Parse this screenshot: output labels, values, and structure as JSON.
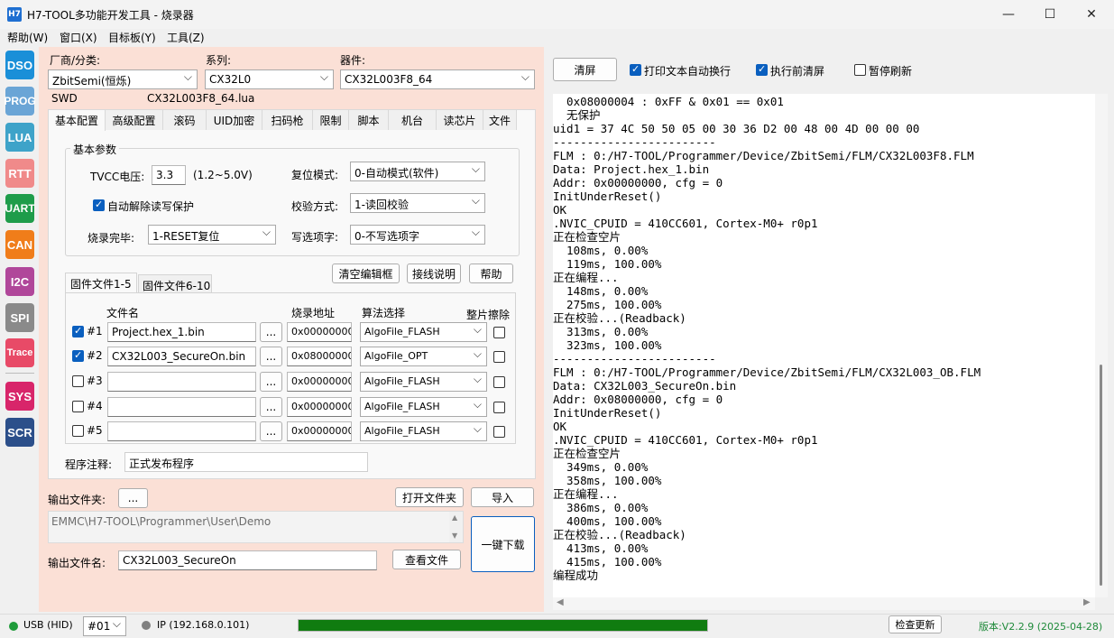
{
  "window": {
    "title": "H7-TOOL多功能开发工具 - 烧录器",
    "icon_text": "H7"
  },
  "menu": [
    "帮助(W)",
    "窗口(X)",
    "目标板(Y)",
    "工具(Z)"
  ],
  "tools": [
    {
      "label": "DSO",
      "color": "#1a8fd8"
    },
    {
      "label": "PROG",
      "color": "#6aa5d6"
    },
    {
      "label": "LUA",
      "color": "#3ea3c9"
    },
    {
      "label": "RTT",
      "color": "#f08a8a"
    },
    {
      "label": "UART",
      "color": "#1e9c4a"
    },
    {
      "label": "CAN",
      "color": "#f07d1a"
    },
    {
      "label": "I2C",
      "color": "#b0479a"
    },
    {
      "label": "SPI",
      "color": "#8a8a8a"
    },
    {
      "label": "Trace",
      "color": "#e84a67"
    },
    {
      "label": "SYS",
      "color": "#d8256a"
    },
    {
      "label": "SCR",
      "color": "#2c4f8a"
    }
  ],
  "device_select": {
    "vendor_label": "厂商/分类:",
    "vendor_value": "ZbitSemi(恒烁)",
    "series_label": "系列:",
    "series_value": "CX32L0",
    "device_label": "器件:",
    "device_value": "CX32L003F8_64",
    "interface": "SWD",
    "lua_file": "CX32L003F8_64.lua"
  },
  "tabs": [
    "基本配置",
    "高级配置",
    "滚码",
    "UID加密",
    "扫码枪",
    "限制",
    "脚本",
    "机台",
    "读芯片",
    "文件"
  ],
  "basic": {
    "group_title": "基本参数",
    "tvcc_label": "TVCC电压:",
    "tvcc_value": "3.3",
    "tvcc_range": "(1.2~5.0V)",
    "reset_label": "复位模式:",
    "reset_value": "0-自动模式(软件)",
    "auto_unprotect_label": "自动解除读写保护",
    "verify_label": "校验方式:",
    "verify_value": "1-读回校验",
    "after_label": "烧录完毕:",
    "after_value": "1-RESET复位",
    "option_label": "写选项字:",
    "option_value": "0-不写选项字"
  },
  "file_section": {
    "subtab1": "固件文件1-5",
    "subtab2": "固件文件6-10",
    "clear_btn": "清空编辑框",
    "wiring_btn": "接线说明",
    "help_btn": "帮助",
    "col_file": "文件名",
    "col_addr": "烧录地址",
    "col_algo": "算法选择",
    "col_erase": "整片擦除",
    "browse": "...",
    "rows": [
      {
        "id": "#1",
        "checked": true,
        "file": "Project.hex_1.bin",
        "addr": "0x00000000",
        "algo": "AlgoFile_FLASH"
      },
      {
        "id": "#2",
        "checked": true,
        "file": "CX32L003_SecureOn.bin",
        "addr": "0x08000000",
        "algo": "AlgoFile_OPT"
      },
      {
        "id": "#3",
        "checked": false,
        "file": "",
        "addr": "0x00000000",
        "algo": "AlgoFile_FLASH"
      },
      {
        "id": "#4",
        "checked": false,
        "file": "",
        "addr": "0x00000000",
        "algo": "AlgoFile_FLASH"
      },
      {
        "id": "#5",
        "checked": false,
        "file": "",
        "addr": "0x00000000",
        "algo": "AlgoFile_FLASH"
      }
    ],
    "note_label": "程序注释:",
    "note_value": "正式发布程序"
  },
  "output": {
    "folder_label": "输出文件夹:",
    "folder_btn": "...",
    "open_folder_btn": "打开文件夹",
    "import_btn": "导入",
    "folder_path": "EMMC\\H7-TOOL\\Programmer\\User\\Demo",
    "download_btn": "一键下载",
    "filename_label": "输出文件名:",
    "filename_value": "CX32L003_SecureOn",
    "view_btn": "查看文件"
  },
  "log_toolbar": {
    "clear_btn": "清屏",
    "wrap_label": "打印文本自动换行",
    "clear_before_label": "执行前清屏",
    "pause_label": "暂停刷新"
  },
  "log_lines": [
    "  0x08000004 : 0xFF & 0x01 == 0x01",
    "  无保护",
    "uid1 = 37 4C 50 50 05 00 30 36 D2 00 48 00 4D 00 00 00",
    "------------------------",
    "FLM : 0:/H7-TOOL/Programmer/Device/ZbitSemi/FLM/CX32L003F8.FLM",
    "Data: Project.hex_1.bin",
    "Addr: 0x00000000, cfg = 0",
    "InitUnderReset()",
    "OK",
    ".NVIC_CPUID = 410CC601, Cortex-M0+ r0p1",
    "正在检查空片",
    "  108ms, 0.00%",
    "  119ms, 100.00%",
    "正在编程...",
    "  148ms, 0.00%",
    "  275ms, 100.00%",
    "正在校验...(Readback)",
    "  313ms, 0.00%",
    "  323ms, 100.00%",
    "------------------------",
    "FLM : 0:/H7-TOOL/Programmer/Device/ZbitSemi/FLM/CX32L003_OB.FLM",
    "Data: CX32L003_SecureOn.bin",
    "Addr: 0x08000000, cfg = 0",
    "InitUnderReset()",
    "OK",
    ".NVIC_CPUID = 410CC601, Cortex-M0+ r0p1",
    "正在检查空片",
    "  349ms, 0.00%",
    "  358ms, 100.00%",
    "正在编程...",
    "  386ms, 0.00%",
    "  400ms, 100.00%",
    "正在校验...(Readback)",
    "  413ms, 0.00%",
    "  415ms, 100.00%",
    "编程成功"
  ],
  "status": {
    "usb_label": "USB (HID)",
    "device_no": "#01",
    "ip_label": "IP (192.168.0.101)",
    "progress": 1.0,
    "check_update_btn": "检查更新",
    "version": "版本:V2.2.9 (2025-04-28)"
  }
}
